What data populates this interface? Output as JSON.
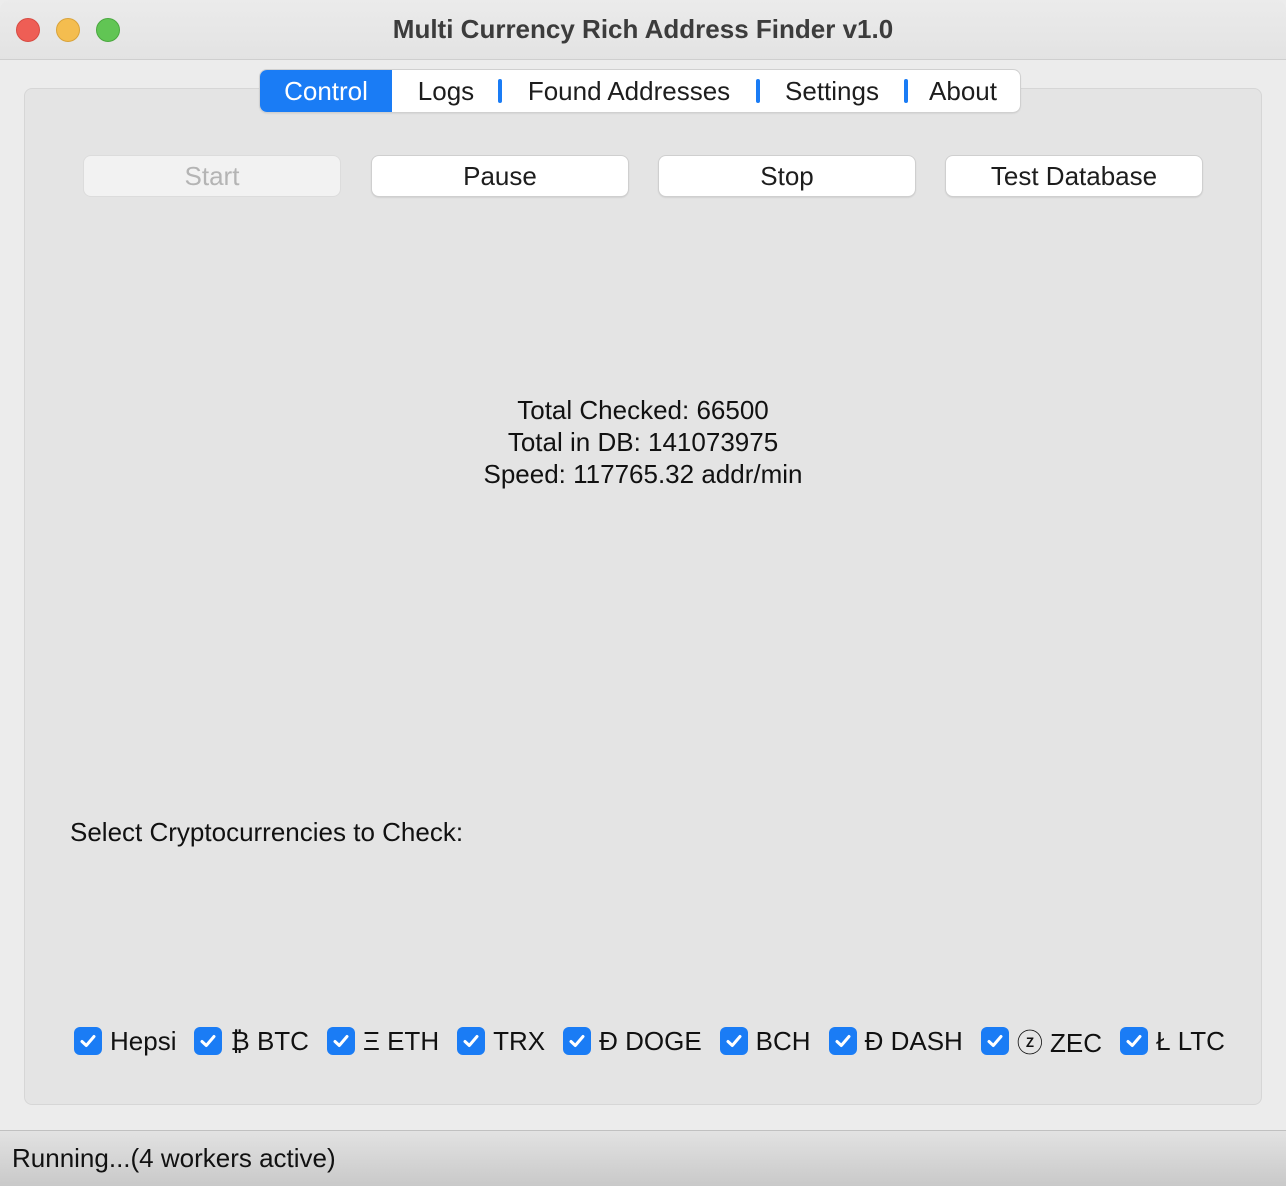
{
  "window": {
    "title": "Multi Currency Rich Address Finder v1.0"
  },
  "tabs": [
    {
      "label": "Control",
      "active": true
    },
    {
      "label": "Logs",
      "active": false
    },
    {
      "label": "Found Addresses",
      "active": false
    },
    {
      "label": "Settings",
      "active": false
    },
    {
      "label": "About",
      "active": false
    }
  ],
  "controls": {
    "start_label": "Start",
    "start_enabled": false,
    "pause_label": "Pause",
    "stop_label": "Stop",
    "test_db_label": "Test Database"
  },
  "stats": {
    "total_checked": "Total Checked: 66500",
    "total_in_db": "Total in DB: 141073975",
    "speed": "Speed: 117765.32 addr/min"
  },
  "select_label": "Select Cryptocurrencies to Check:",
  "currencies": [
    {
      "label": "Hepsi",
      "checked": true
    },
    {
      "label": "₿ BTC",
      "checked": true
    },
    {
      "label": "Ξ ETH",
      "checked": true
    },
    {
      "label": "TRX",
      "checked": true
    },
    {
      "label": "Ð DOGE",
      "checked": true
    },
    {
      "label": "BCH",
      "checked": true
    },
    {
      "label": "Đ DASH",
      "checked": true
    },
    {
      "label": "ⓩ ZEC",
      "checked": true
    },
    {
      "label": "Ł LTC",
      "checked": true
    }
  ],
  "status": {
    "text": "Running...(4 workers active)"
  },
  "colors": {
    "accent": "#1a7cf5",
    "close": "#ee5e55",
    "minimize": "#f4bd4f",
    "maximize": "#61c554"
  }
}
